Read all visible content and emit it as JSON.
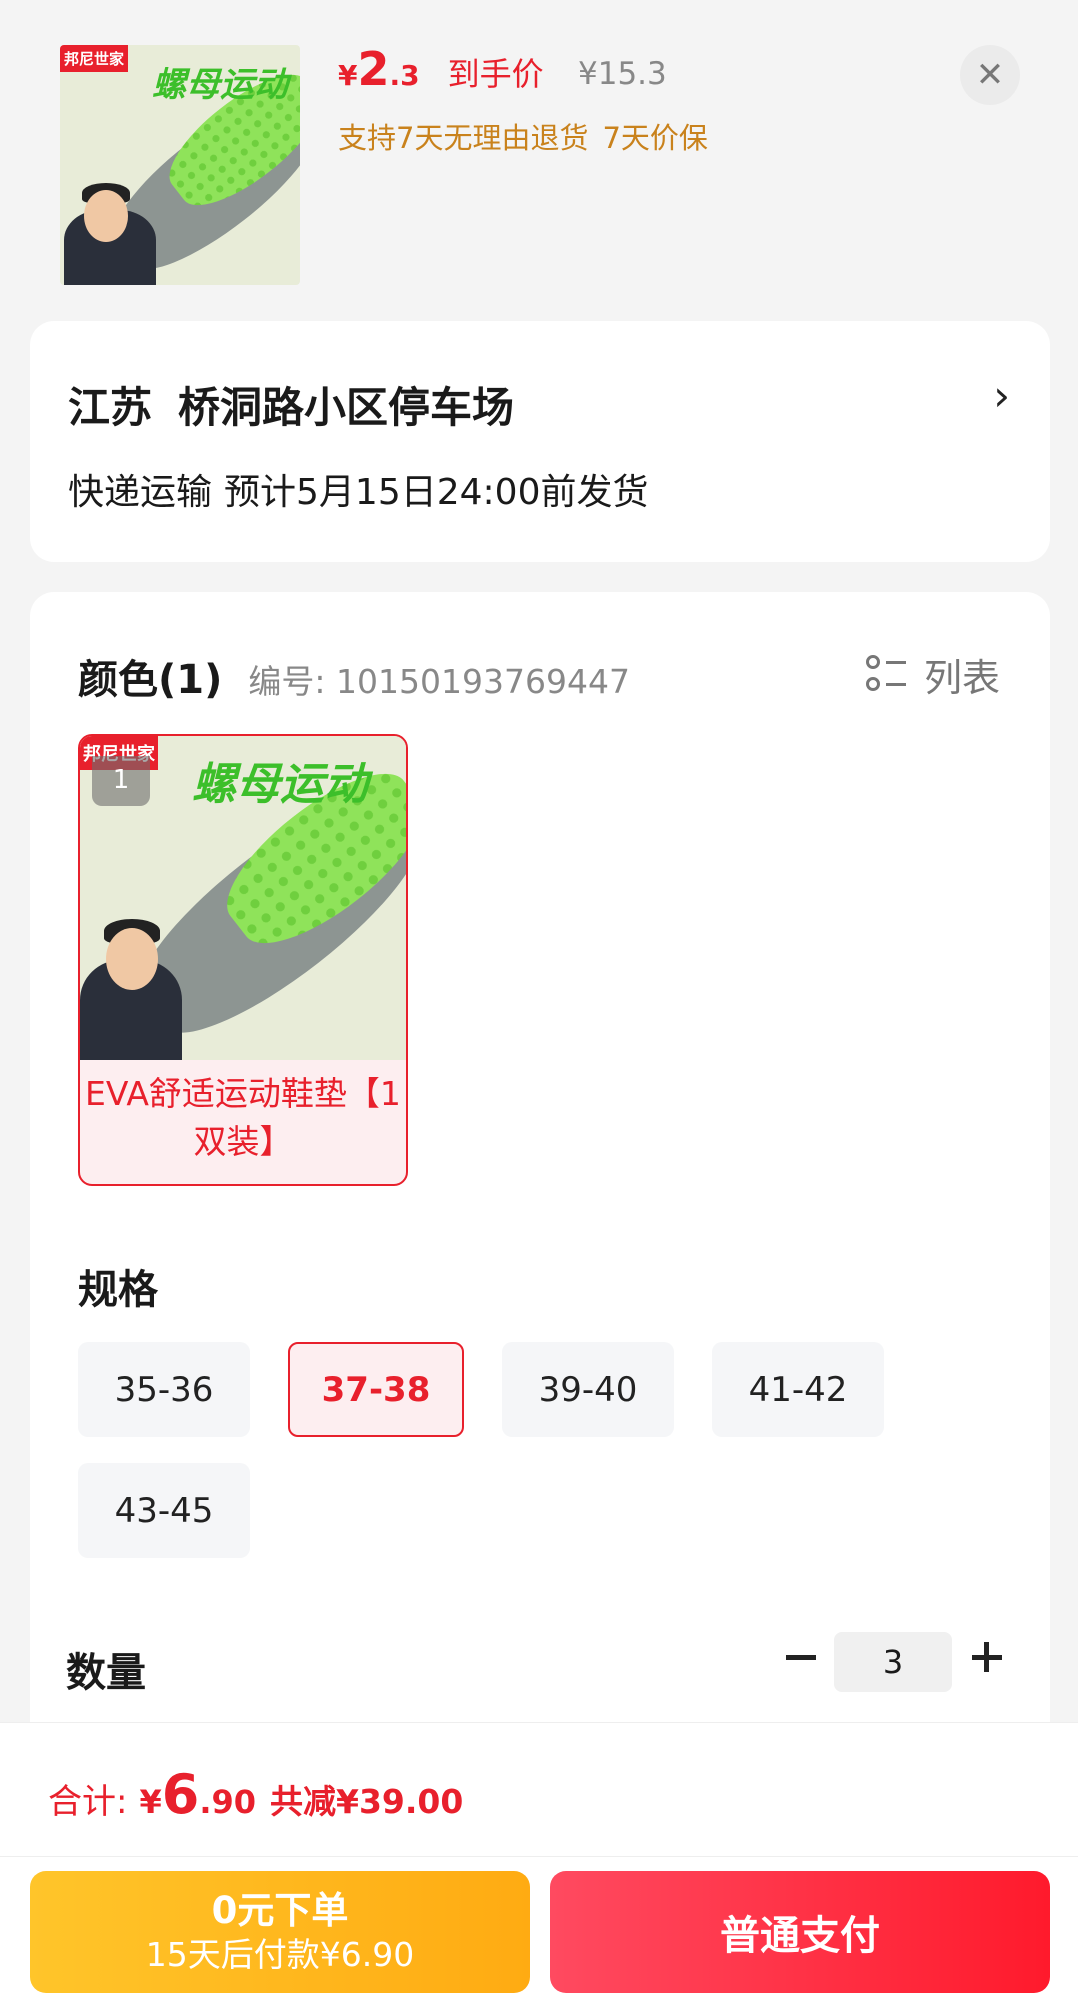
{
  "header": {
    "product_image": {
      "brand": "邦尼世家",
      "title_art": "螺母运动"
    },
    "price": {
      "currency": "¥",
      "integer": "2",
      "decimal": ".3",
      "label": "到手价"
    },
    "original_price": "¥15.3",
    "guarantees": [
      "支持7天无理由退货",
      "7天价保"
    ],
    "close_glyph": "✕"
  },
  "address": {
    "province": "江苏",
    "detail": "桥洞路小区停车场",
    "chevron": "›",
    "shipping_method": "快递运输",
    "estimate": "预计5月15日24:00前发货"
  },
  "color": {
    "title": "颜色(1)",
    "code": "编号: 10150193769447",
    "list_toggle_label": "列表",
    "options": [
      {
        "badge": "1",
        "label": "EVA舒适运动鞋垫【1双装】",
        "selected": true
      }
    ]
  },
  "spec": {
    "title": "规格",
    "options": [
      "35-36",
      "37-38",
      "39-40",
      "41-42",
      "43-45"
    ],
    "selected": "37-38"
  },
  "quantity": {
    "title": "数量",
    "value": "3"
  },
  "footer": {
    "total_label": "合计:",
    "total_currency": "¥",
    "total_integer": "6",
    "total_decimal": ".90",
    "saved": "共减¥39.00",
    "later_pay": {
      "line1": "0元下单",
      "line2": "15天后付款¥6.90"
    },
    "pay_label": "普通支付"
  },
  "colors": {
    "accent_red": "#e8202c",
    "guarantee_orange": "#c9821c",
    "later_yellow": "#ffb81c",
    "pay_red": "#ff2638"
  }
}
